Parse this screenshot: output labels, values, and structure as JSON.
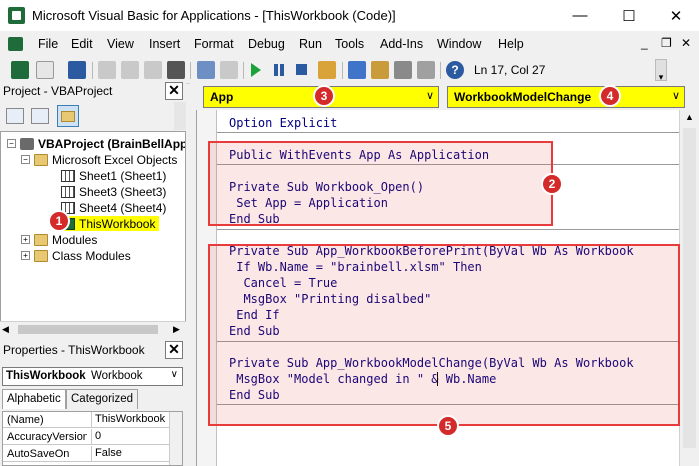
{
  "window": {
    "title": "Microsoft Visual Basic for Applications - [ThisWorkbook (Code)]",
    "minimize_glyph": "—",
    "maximize_glyph": "☐",
    "close_glyph": "✕"
  },
  "menubar": {
    "items": [
      "File",
      "Edit",
      "View",
      "Insert",
      "Format",
      "Debug",
      "Run",
      "Tools",
      "Add-Ins",
      "Window",
      "Help"
    ],
    "mdi_min": "_",
    "mdi_restore": "❐",
    "mdi_close": "✕"
  },
  "toolbar": {
    "position_text": "Ln 17, Col 27"
  },
  "project_pane": {
    "title": "Project - VBAProject",
    "close_glyph": "✕",
    "tree": {
      "root": "VBAProject (BrainBellApp",
      "excel_objects": "Microsoft Excel Objects",
      "sheet1": "Sheet1 (Sheet1)",
      "sheet3": "Sheet3 (Sheet3)",
      "sheet4": "Sheet4 (Sheet4)",
      "thisworkbook": "ThisWorkbook",
      "modules": "Modules",
      "class_modules": "Class Modules"
    }
  },
  "properties_pane": {
    "title": "Properties - ThisWorkbook",
    "close_glyph": "✕",
    "combo_name": "ThisWorkbook",
    "combo_type": "Workbook",
    "tabs": [
      "Alphabetic",
      "Categorized"
    ],
    "rows": [
      {
        "name": "(Name)",
        "value": "ThisWorkbook"
      },
      {
        "name": "AccuracyVersion",
        "value": "0"
      },
      {
        "name": "AutoSaveOn",
        "value": "False"
      }
    ]
  },
  "code_window": {
    "object_combo": "App",
    "procedure_combo": "WorkbookModelChange",
    "lines": [
      "Option Explicit",
      "",
      "Public WithEvents App As Application",
      "",
      "Private Sub Workbook_Open()",
      " Set App = Application",
      "End Sub",
      "",
      "Private Sub App_WorkbookBeforePrint(ByVal Wb As Workbook",
      " If Wb.Name = \"brainbell.xlsm\" Then",
      "  Cancel = True",
      "  MsgBox \"Printing disalbed\"",
      " End If",
      "End Sub",
      "",
      "Private Sub App_WorkbookModelChange(ByVal Wb As Workbook",
      " MsgBox \"Model changed in \" & Wb.Name",
      "End Sub"
    ]
  },
  "annotations": {
    "badges": [
      "1",
      "2",
      "3",
      "4",
      "5"
    ],
    "accent_color": "#d42a2a"
  }
}
